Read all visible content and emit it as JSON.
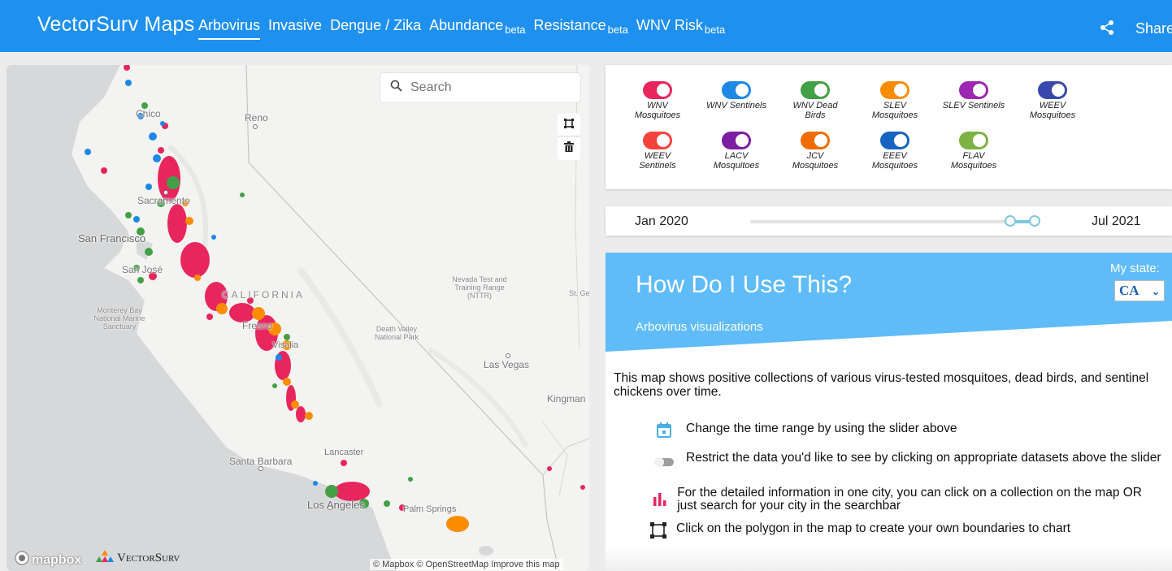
{
  "header": {
    "brand": "VectorSurv Maps",
    "tabs": [
      {
        "label": "Arbovirus",
        "beta": ""
      },
      {
        "label": "Invasive",
        "beta": ""
      },
      {
        "label": "Dengue / Zika",
        "beta": ""
      },
      {
        "label": "Abundance",
        "beta": "beta"
      },
      {
        "label": "Resistance",
        "beta": "beta"
      },
      {
        "label": "WNV Risk",
        "beta": "beta"
      }
    ],
    "share_label": "Share"
  },
  "map": {
    "search_placeholder": "Search",
    "labels": {
      "reno": "Reno",
      "chico": "Chico",
      "sacramento": "Sacramento",
      "san_francisco": "San Francisco",
      "san_jose": "San José",
      "california": "CALIFORNIA",
      "monterey": "Monterey Bay National Marine Sanctuary",
      "nevada_test": "Nevada Test and Training Range (NTTR)",
      "st_george": "St. Ge",
      "fresno": "Fresno",
      "visalia": "Visalia",
      "death_valley": "Death Valley National Park",
      "las_vegas": "Las Vegas",
      "kingman": "Kingman",
      "lancaster": "Lancaster",
      "santa_barbara": "Santa Barbara",
      "los_angeles": "Los Angeles",
      "palm_springs": "Palm Springs"
    },
    "attribution": "© Mapbox © OpenStreetMap Improve this map",
    "mapbox_logo": "mapbox",
    "vectorsurv_logo": "VectorSurv"
  },
  "toggles": [
    {
      "label": "WNV Mosquitoes",
      "color": "#e8265e",
      "on": true
    },
    {
      "label": "WNV Sentinels",
      "color": "#1e88e5",
      "on": true
    },
    {
      "label": "WNV Dead Birds",
      "color": "#43a047",
      "on": true
    },
    {
      "label": "SLEV Mosquitoes",
      "color": "#fb8c00",
      "on": true
    },
    {
      "label": "SLEV Sentinels",
      "color": "#9c27b0",
      "on": true
    },
    {
      "label": "WEEV Mosquitoes",
      "color": "#3949ab",
      "on": true
    },
    {
      "label": "WEEV Sentinels",
      "color": "#f4433c",
      "on": true
    },
    {
      "label": "LACV Mosquitoes",
      "color": "#7b1fa2",
      "on": true
    },
    {
      "label": "JCV Mosquitoes",
      "color": "#ef6c00",
      "on": true
    },
    {
      "label": "EEEV Mosquitoes",
      "color": "#1565c0",
      "on": true
    },
    {
      "label": "FLAV Mosquitoes",
      "color": "#7cb342",
      "on": true
    }
  ],
  "slider": {
    "start_label": "Jan 2020",
    "end_label": "Jul 2021"
  },
  "help": {
    "title": "How Do I Use This?",
    "subtitle": "Arbovirus visualizations",
    "state_label": "My state:",
    "state_value": "CA",
    "description": "This map shows positive collections of various virus-tested mosquitoes, dead birds, and sentinel chickens over time.",
    "tips": [
      {
        "icon": "calendar-icon",
        "text": "Change the time range by using the slider above"
      },
      {
        "icon": "toggle-icon",
        "text": "Restrict the data you'd like to see by clicking on appropriate datasets above the slider"
      },
      {
        "icon": "bar-chart-icon",
        "text": "For the detailed information in one city, you can click on a collection on the map OR just search for your city in the searchbar"
      },
      {
        "icon": "polygon-icon",
        "text": "Click on the polygon in the map to create your own boundaries to chart"
      }
    ]
  },
  "colors": {
    "header_bg": "#1e90f0",
    "banner_bg": "#5fbcf8",
    "wnv_mosquito": "#e8265e",
    "sentinel": "#1e88e5",
    "dead_bird": "#43a047",
    "slev": "#fb8c00"
  }
}
